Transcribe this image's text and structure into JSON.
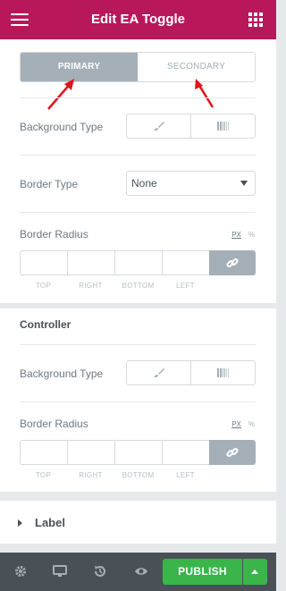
{
  "header": {
    "title": "Edit EA Toggle",
    "menu_icon": "hamburger-icon",
    "apps_icon": "grid-icon",
    "brand_color": "#b8185a"
  },
  "tabs": [
    {
      "label": "PRIMARY",
      "active": true
    },
    {
      "label": "SECONDARY",
      "active": false
    }
  ],
  "primary_section": {
    "background_type": {
      "label": "Background Type",
      "options": [
        "brush-icon",
        "gradient-icon"
      ]
    },
    "border_type": {
      "label": "Border Type",
      "value": "None"
    },
    "border_radius": {
      "label": "Border Radius",
      "units": [
        "PX",
        "%"
      ],
      "fields": [
        "TOP",
        "RIGHT",
        "BOTTOM",
        "LEFT"
      ],
      "link_icon": "link-icon"
    }
  },
  "controller_section": {
    "heading": "Controller",
    "background_type": {
      "label": "Background Type",
      "options": [
        "brush-icon",
        "gradient-icon"
      ]
    },
    "border_radius": {
      "label": "Border Radius",
      "units": [
        "PX",
        "%"
      ],
      "fields": [
        "TOP",
        "RIGHT",
        "BOTTOM",
        "LEFT"
      ],
      "link_icon": "link-icon"
    }
  },
  "collapsed_section": {
    "label": "Label"
  },
  "footer": {
    "icons": [
      "settings-icon",
      "responsive-icon",
      "history-icon",
      "preview-icon"
    ],
    "publish_label": "PUBLISH",
    "publish_color": "#39b54a"
  }
}
